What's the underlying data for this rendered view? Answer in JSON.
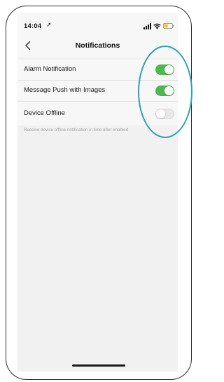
{
  "status_bar": {
    "time": "14:04",
    "location_glyph": "➚",
    "icons": [
      "signal-icon",
      "wifi-icon",
      "battery-icon"
    ]
  },
  "nav": {
    "title": "Notifications",
    "back_glyph": "<"
  },
  "settings": [
    {
      "label": "Alarm Notification",
      "enabled": true
    },
    {
      "label": "Message Push with Images",
      "enabled": true
    },
    {
      "label": "Device Offline",
      "enabled": false
    }
  ],
  "hint_text": "Receive device offline notification in time after enabled",
  "colors": {
    "toggle_on": "#4cb84e",
    "toggle_off": "#e8e8e8",
    "highlight": "#2aa3b2",
    "battery": "#f0c419"
  }
}
